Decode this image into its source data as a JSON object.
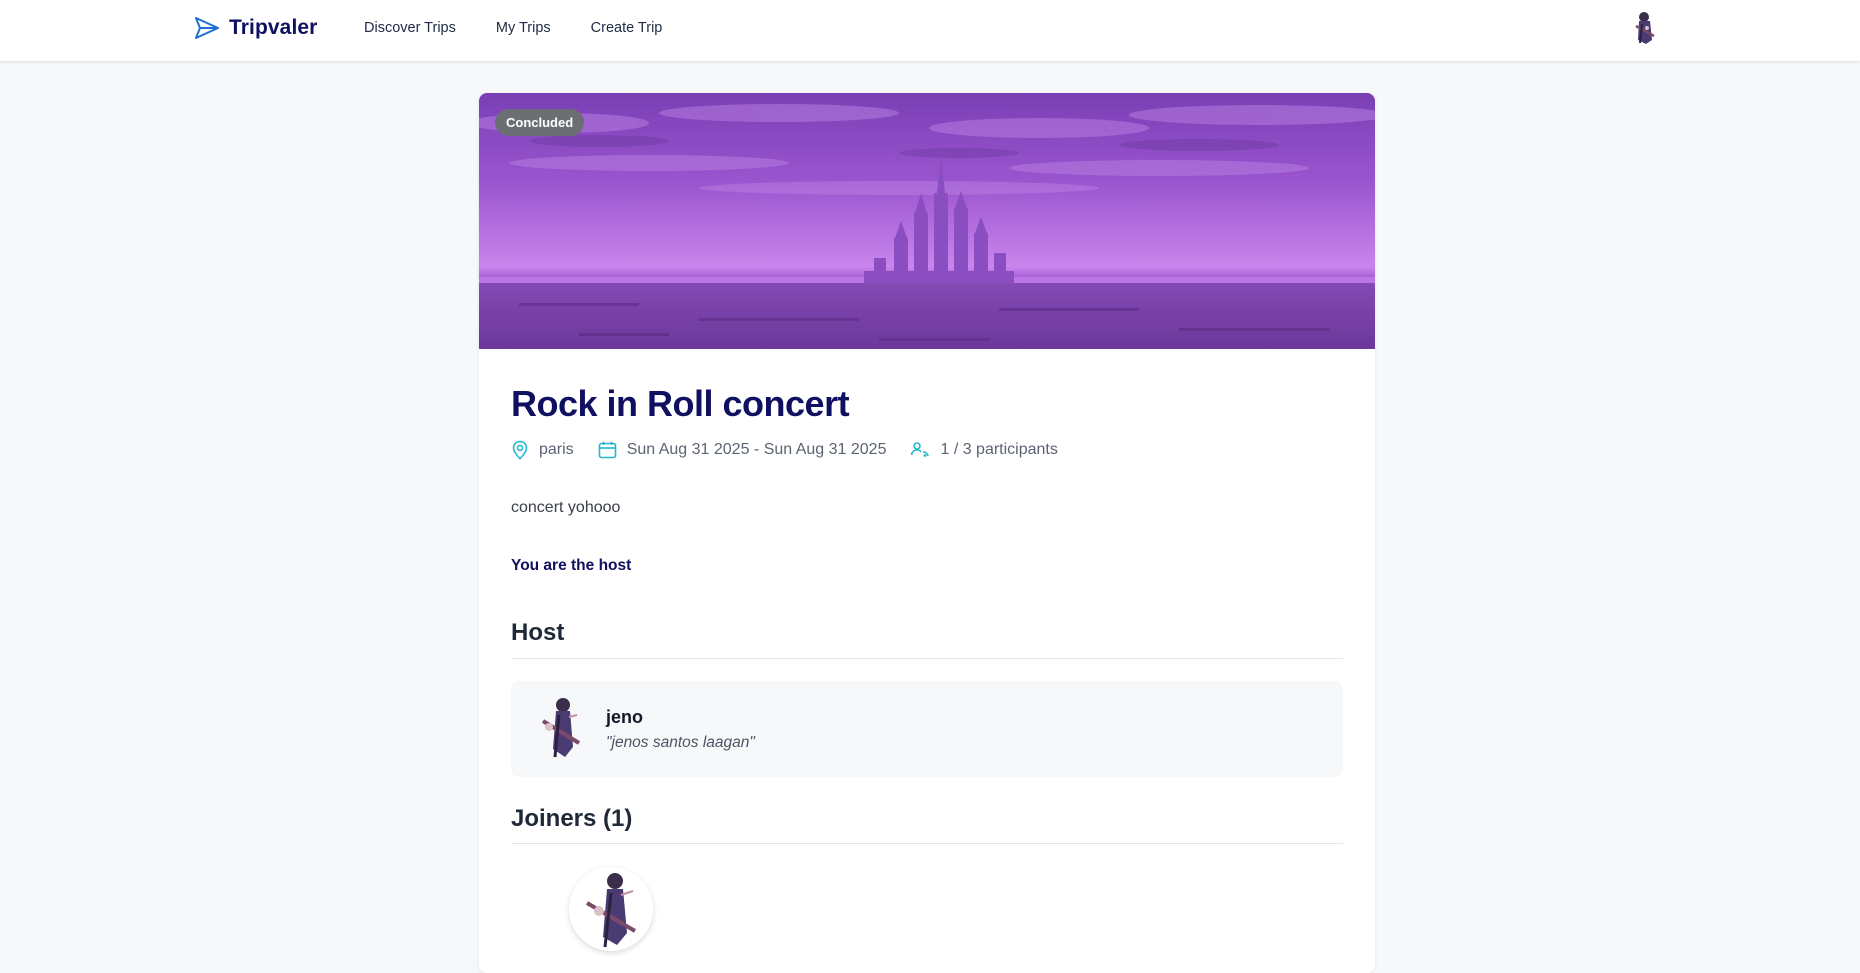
{
  "app": {
    "brand": "Tripvaler"
  },
  "nav": {
    "links": [
      {
        "label": "Discover Trips"
      },
      {
        "label": "My Trips"
      },
      {
        "label": "Create Trip"
      }
    ]
  },
  "trip": {
    "status": "Concluded",
    "title": "Rock in Roll concert",
    "location": "paris",
    "dates": "Sun Aug 31 2025 - Sun Aug 31 2025",
    "participants": "1 / 3 participants",
    "description": "concert yohooo",
    "host_note": "You are the host"
  },
  "host_section": {
    "title": "Host",
    "name": "jeno",
    "bio": "\"jenos santos laagan\""
  },
  "joiners_section": {
    "title": "Joiners (1)"
  },
  "icons": {
    "logo": "paper-plane-icon",
    "location": "map-pin-icon",
    "dates": "calendar-icon",
    "participants": "users-icon"
  },
  "colors": {
    "brand": "#0f1060",
    "accent": "#22b8cf",
    "badge": "#6b6e73",
    "banner": "#9b4fd0"
  }
}
